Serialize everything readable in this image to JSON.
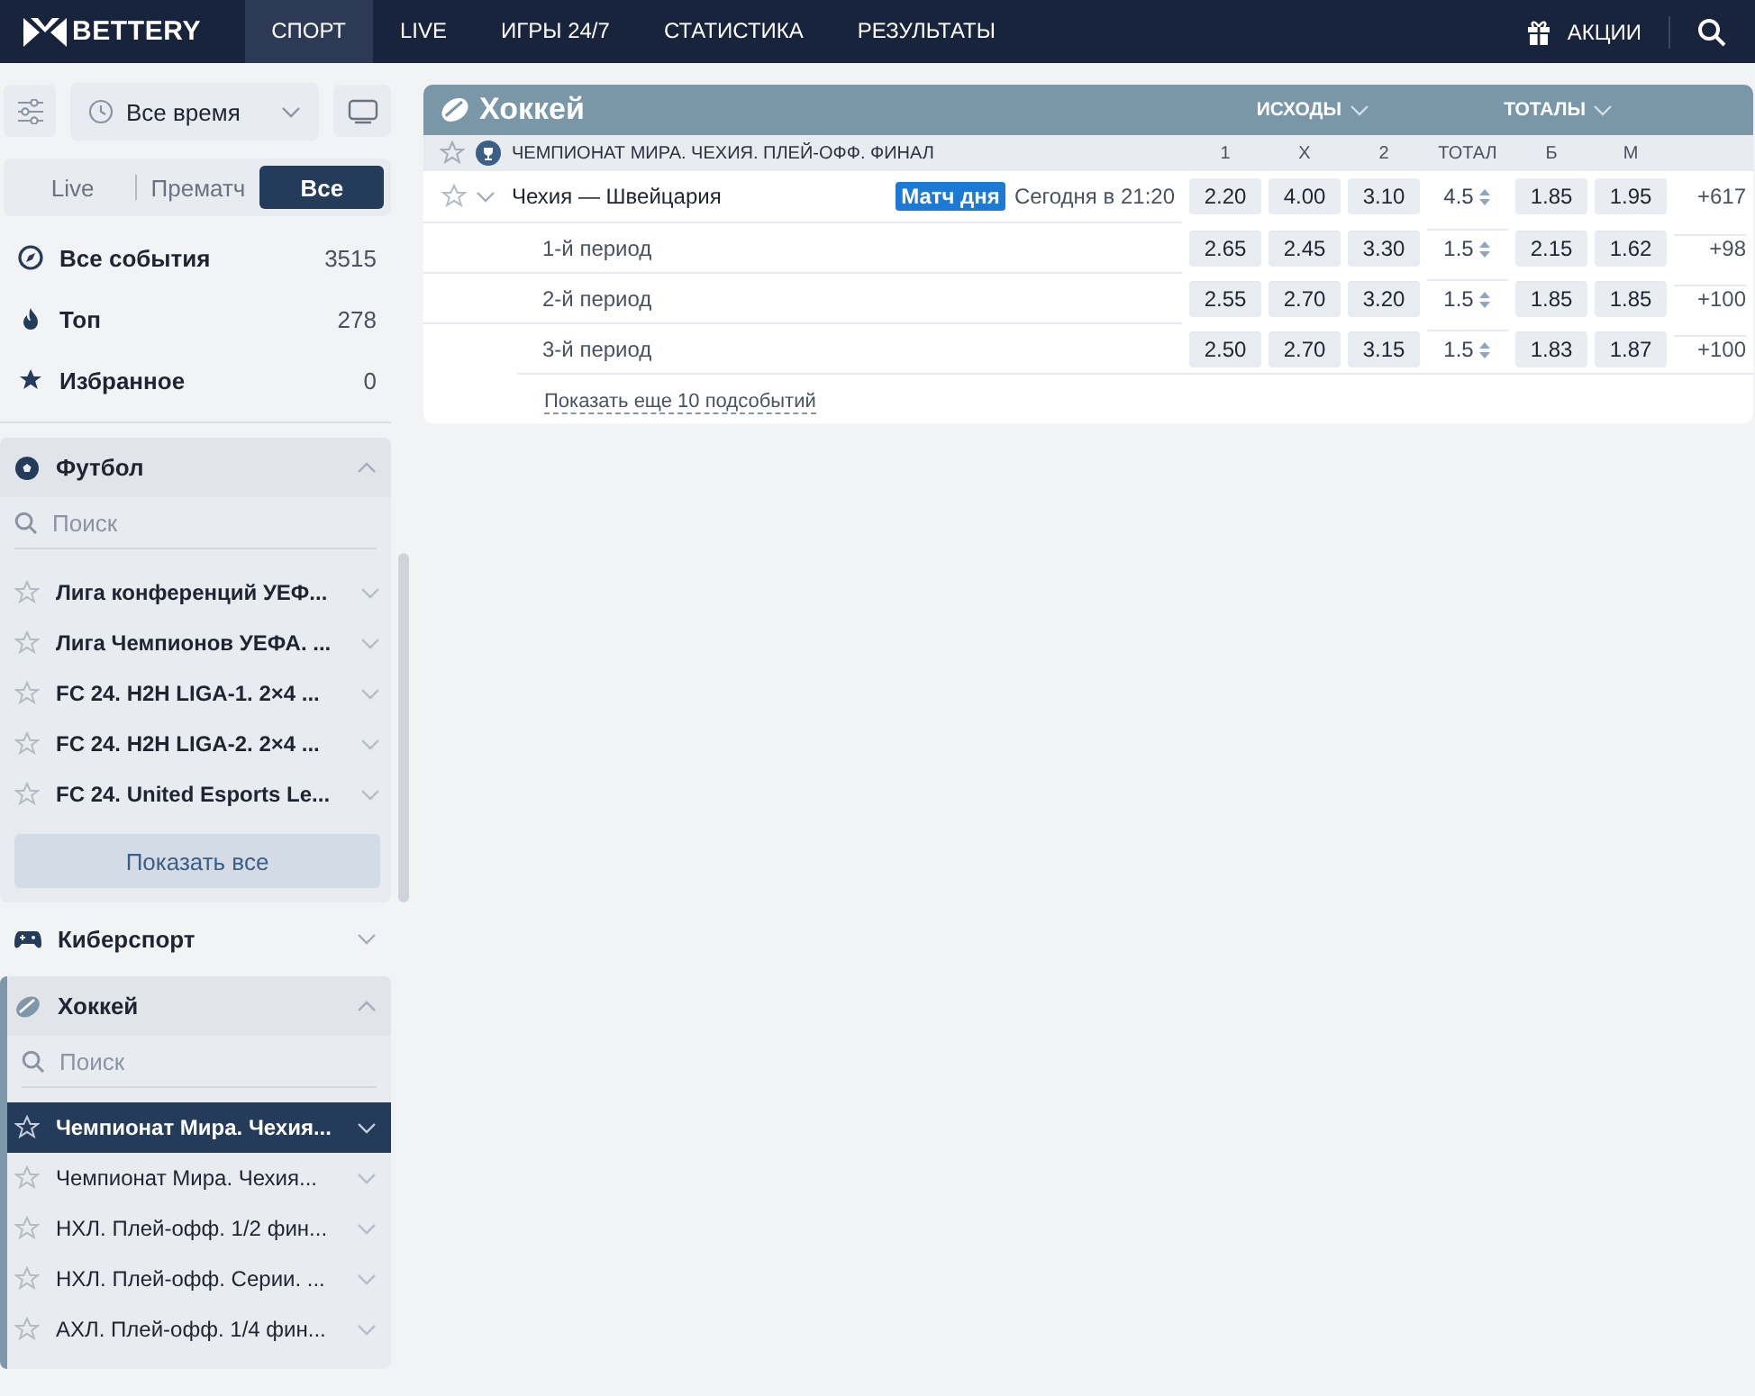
{
  "header": {
    "logo": "BETTERY",
    "nav": [
      {
        "label": "СПОРТ",
        "selected": true
      },
      {
        "label": "LIVE",
        "selected": false
      },
      {
        "label": "ИГРЫ 24/7",
        "selected": false
      },
      {
        "label": "СТАТИСТИКА",
        "selected": false
      },
      {
        "label": "РЕЗУЛЬТАТЫ",
        "selected": false
      }
    ],
    "promo": "АКЦИИ"
  },
  "sidebar": {
    "time_filter": "Все время",
    "mode_tabs": [
      {
        "label": "Live",
        "selected": false
      },
      {
        "label": "Прематч",
        "selected": false
      },
      {
        "label": "Все",
        "selected": true
      }
    ],
    "quick": [
      {
        "kind": "compass",
        "label": "Все события",
        "count": "3515"
      },
      {
        "kind": "fire",
        "label": "Топ",
        "count": "278"
      },
      {
        "kind": "star",
        "label": "Избранное",
        "count": "0"
      }
    ],
    "sports": [
      {
        "kind": "soccer",
        "name": "Футбол",
        "expanded": true,
        "active": false,
        "placeholder": "Поиск",
        "scrollable": true,
        "leagues": [
          {
            "name": "Лига конференций УЕФ...",
            "selected": false
          },
          {
            "name": "Лига Чемпионов УЕФА. ...",
            "selected": false
          },
          {
            "name": "FC 24. H2H LIGA-1. 2×4 ...",
            "selected": false
          },
          {
            "name": "FC 24. H2H LIGA-2. 2×4 ...",
            "selected": false
          },
          {
            "name": "FC 24. United Esports Le...",
            "selected": false
          }
        ],
        "show_all": "Показать все"
      },
      {
        "kind": "gamepad",
        "name": "Киберспорт",
        "expanded": false,
        "active": false
      },
      {
        "kind": "hockey",
        "name": "Хоккей",
        "expanded": true,
        "active": true,
        "placeholder": "Поиск",
        "scrollable": false,
        "leagues": [
          {
            "name": "Чемпионат Мира. Чехия...",
            "selected": true
          },
          {
            "name": "Чемпионат Мира. Чехия...",
            "selected": false
          },
          {
            "name": "НХЛ. Плей-офф. 1/2 фин...",
            "selected": false
          },
          {
            "name": "НХЛ. Плей-офф. Серии. ...",
            "selected": false
          },
          {
            "name": "АХЛ. Плей-офф. 1/4 фин...",
            "selected": false
          }
        ]
      }
    ]
  },
  "main": {
    "sport": "Хоккей",
    "groups": [
      "ИСХОДЫ",
      "ТОТАЛЫ"
    ],
    "tournament": "ЧЕМПИОНАТ МИРА. ЧЕХИЯ. ПЛЕЙ-ОФФ. ФИНАЛ",
    "columns": [
      "1",
      "X",
      "2",
      "ТОТАЛ",
      "Б",
      "М"
    ],
    "rows": [
      {
        "kind": "match",
        "name": "Чехия — Швейцария",
        "badge": "Матч дня",
        "time": "Сегодня в 21:20",
        "odds": [
          "2.20",
          "4.00",
          "3.10"
        ],
        "total": "4.5",
        "over": "1.85",
        "under": "1.95",
        "more": "+617"
      },
      {
        "kind": "period",
        "name": "1-й период",
        "odds": [
          "2.65",
          "2.45",
          "3.30"
        ],
        "total": "1.5",
        "over": "2.15",
        "under": "1.62",
        "more": "+98"
      },
      {
        "kind": "period",
        "name": "2-й период",
        "odds": [
          "2.55",
          "2.70",
          "3.20"
        ],
        "total": "1.5",
        "over": "1.85",
        "under": "1.85",
        "more": "+100"
      },
      {
        "kind": "period",
        "name": "3-й период",
        "odds": [
          "2.50",
          "2.70",
          "3.15"
        ],
        "total": "1.5",
        "over": "1.83",
        "under": "1.87",
        "more": "+100"
      }
    ],
    "show_more": "Показать еще 10 подсобытий"
  }
}
